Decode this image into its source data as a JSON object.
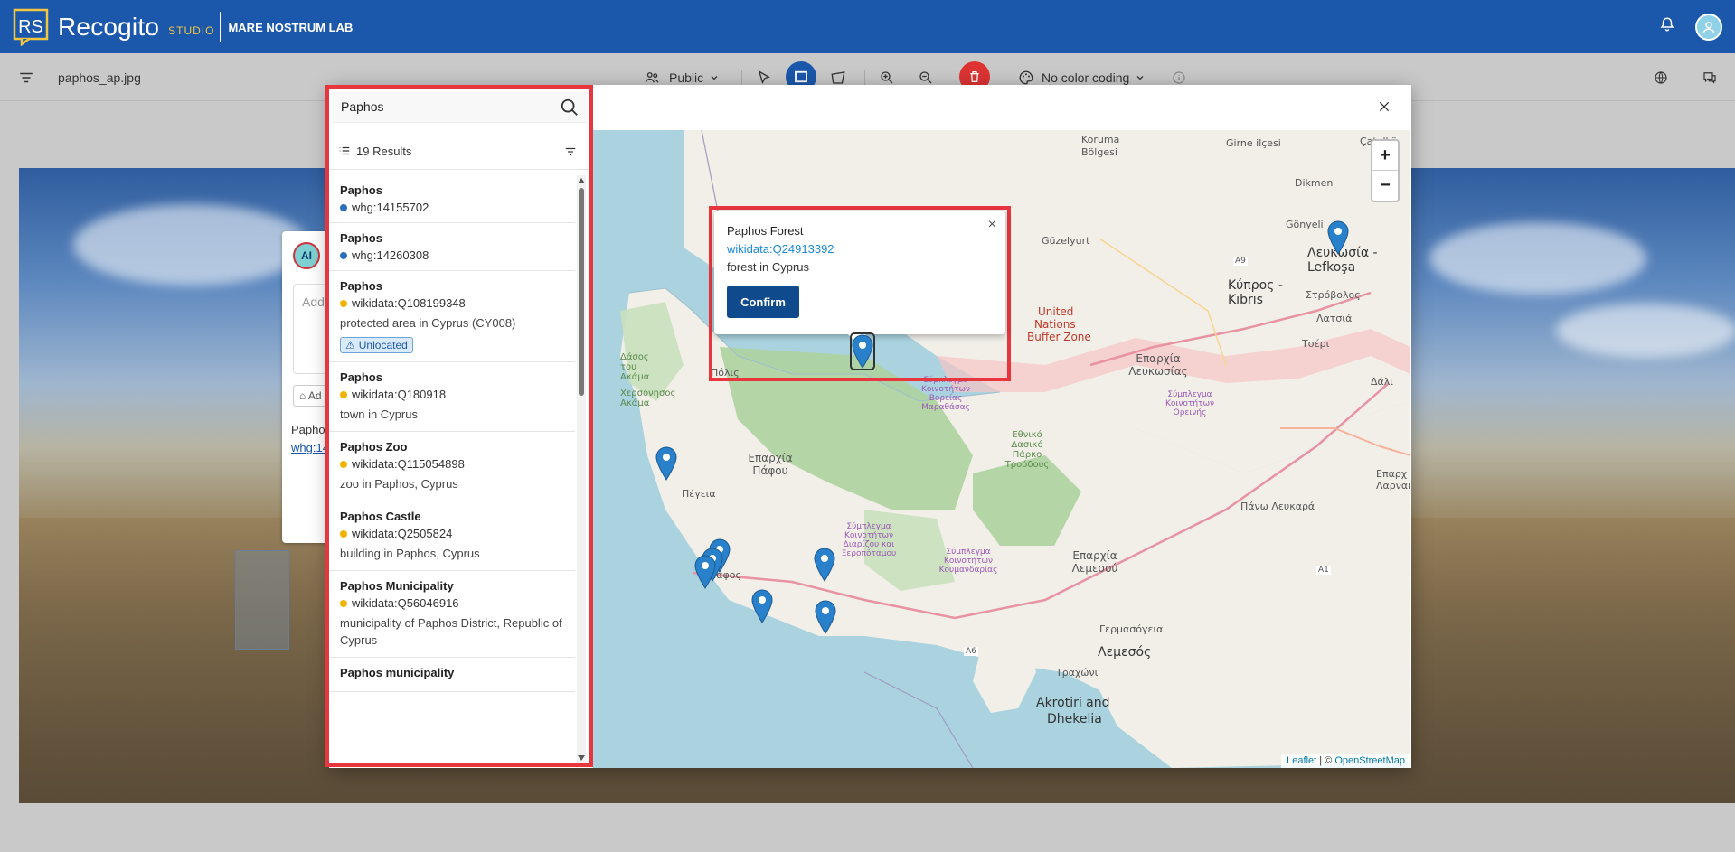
{
  "header": {
    "brand_initials": "RS",
    "brand_name": "Recogito",
    "brand_studio": "STUDIO",
    "org_name": "MARE NOSTRUM LAB"
  },
  "toolbar": {
    "filename": "paphos_ap.jpg",
    "visibility": "Public",
    "color_coding": "No color coding"
  },
  "annotation": {
    "avatar_initials": "AI",
    "placeholder": "Add",
    "tag_label": "Ad",
    "place_title": "Paphos",
    "place_link": "whg:14"
  },
  "search": {
    "query": "Paphos",
    "results_label": "19 Results"
  },
  "results": [
    {
      "title": "Paphos",
      "id": "whg:14155702",
      "source": "whg",
      "desc": "",
      "badge": ""
    },
    {
      "title": "Paphos",
      "id": "whg:14260308",
      "source": "whg",
      "desc": "",
      "badge": ""
    },
    {
      "title": "Paphos",
      "id": "wikidata:Q108199348",
      "source": "wikidata",
      "desc": "protected area in Cyprus (CY008)",
      "badge": "Unlocated"
    },
    {
      "title": "Paphos",
      "id": "wikidata:Q180918",
      "source": "wikidata",
      "desc": "town in Cyprus",
      "badge": ""
    },
    {
      "title": "Paphos Zoo",
      "id": "wikidata:Q115054898",
      "source": "wikidata",
      "desc": "zoo in Paphos, Cyprus",
      "badge": ""
    },
    {
      "title": "Paphos Castle",
      "id": "wikidata:Q2505824",
      "source": "wikidata",
      "desc": "building in Paphos, Cyprus",
      "badge": ""
    },
    {
      "title": "Paphos Municipality",
      "id": "wikidata:Q56046916",
      "source": "wikidata",
      "desc": "municipality of Paphos District, Republic of Cyprus",
      "badge": ""
    },
    {
      "title": "Paphos municipality",
      "id": "",
      "source": "wikidata",
      "desc": "",
      "badge": ""
    }
  ],
  "popup": {
    "title": "Paphos Forest",
    "link": "wikidata:Q24913392",
    "desc": "forest in Cyprus",
    "confirm_label": "Confirm"
  },
  "map": {
    "zoom_in": "+",
    "zoom_out": "−",
    "attribution_leaflet": "Leaflet",
    "attribution_sep": " | © ",
    "attribution_osm": "OpenStreetMap",
    "labels": {
      "koruma": "Koruma",
      "bolgesi": "Bölgesi",
      "girne": "Girne ilçesi",
      "catalkoy": "Çatalkö",
      "dikmen": "Dikmen",
      "gonyeli": "Gönyeli",
      "guzelyurt": "Güzelyurt",
      "lefkosia": "Λευκωσία - Lefkoşa",
      "kypros": "Κύπρος - Kıbrıs",
      "strovolos": "Στρόβολος",
      "latsia": "Λατσιά",
      "tseri": "Τσέρι",
      "dali": "Δάλι",
      "un1": "United",
      "un2": "Nations",
      "un3": "Buffer Zone",
      "eparchia_lef": "Επαρχία Λευκωσίας",
      "polis": "Πόλις",
      "peyia": "Πέγεια",
      "eparchia_paf": "Επαρχία Πάφου",
      "paphos_town": "Πάφος",
      "pano_lefkara": "Πάνω Λευκαρά",
      "eparchia_lem": "Επαρχία Λεμεσού",
      "germasogeia": "Γερμασόγεια",
      "lemesos": "Λεμεσός",
      "trachoni": "Τραχώνι",
      "akrotiri1": "Akrotiri and",
      "akrotiri2": "Dhekelia",
      "eparchia_lar": "Επαρχ Λαρνακ",
      "road_a9": "A9",
      "road_a6": "A6",
      "road_a1": "A1",
      "akamas": "Δάσος του Ακάμα",
      "chersonisos": "Χερσόνησος Ακάμα",
      "ethniko": "Εθνικό Δασικό Πάρκο Τροόδους",
      "koin1": "Σύμπλεγμα Κοινοτήτων Βορείας Μαραθάσας",
      "koin2": "Σύμπλεγμα Κοινοτήτων Ορεινής",
      "koin3": "Σύμπλεγμα Κοινοτήτων Διαρίζου και Ξεροπόταμου",
      "koin4": "Σύμπλεγμα Κοινοτήτων Κουμανδαρίας"
    }
  },
  "colors": {
    "header_bg": "#1b58ab",
    "accent_red": "#e8363f",
    "confirm_bg": "#0e4a8c",
    "whg_dot": "#2c6fb8",
    "wikidata_dot": "#f0b400",
    "sea": "#aad3df",
    "land": "#f2efe9",
    "forest": "#add19e"
  }
}
